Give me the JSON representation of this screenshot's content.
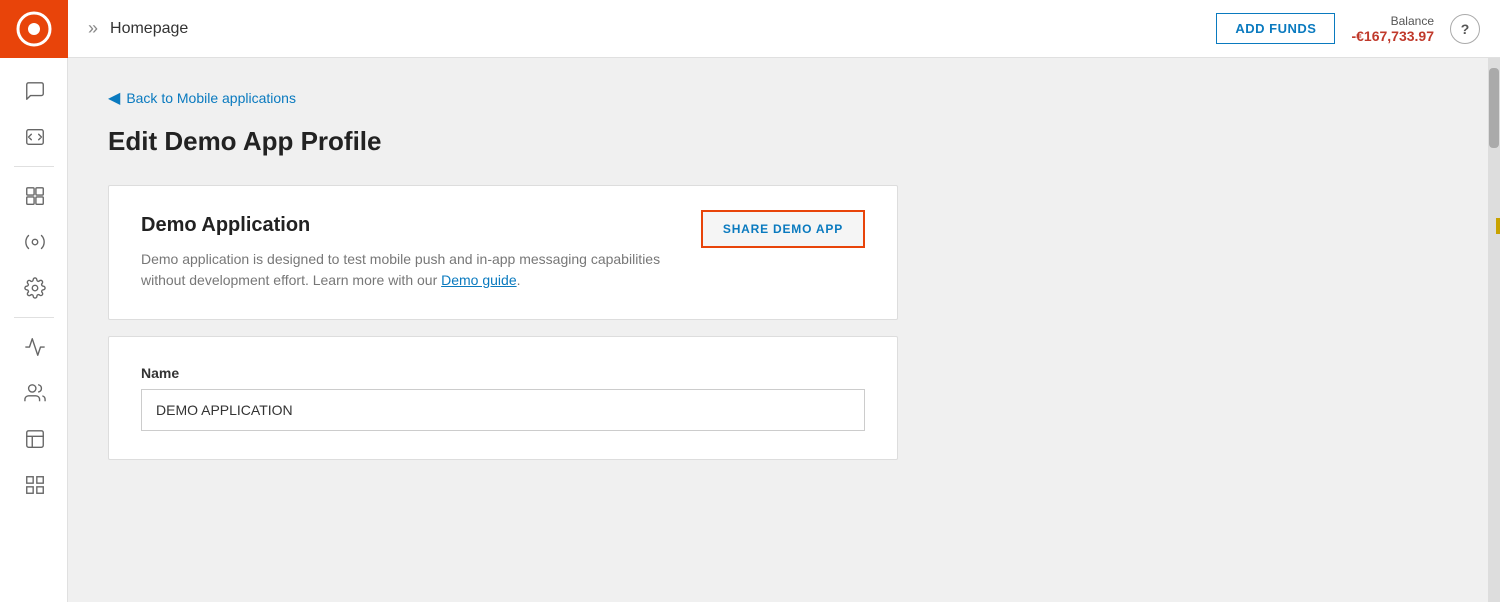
{
  "logo": {
    "alt": "Braze logo"
  },
  "topbar": {
    "breadcrumb": "Homepage",
    "chevron": "»",
    "add_funds_label": "ADD FUNDS",
    "balance_label": "Balance",
    "balance_value": "-€167,733.97",
    "help_icon": "?"
  },
  "sidebar": {
    "items": [
      {
        "name": "chat-icon",
        "label": "Messages"
      },
      {
        "name": "code-icon",
        "label": "Developer"
      },
      {
        "name": "template-icon",
        "label": "Templates"
      },
      {
        "name": "automation-icon",
        "label": "Automation"
      },
      {
        "name": "settings-icon",
        "label": "Settings"
      },
      {
        "name": "analytics-icon",
        "label": "Analytics"
      },
      {
        "name": "audience-icon",
        "label": "Audience"
      },
      {
        "name": "reports-icon",
        "label": "Reports"
      },
      {
        "name": "grid-icon",
        "label": "Grid"
      }
    ]
  },
  "back_link": "Back to Mobile applications",
  "page_title": "Edit Demo App Profile",
  "demo_card": {
    "title": "Demo Application",
    "description_part1": "Demo application is designed to test mobile push and in-app messaging capabilities without development effort. Learn more with our ",
    "demo_guide_link": "Demo guide",
    "description_part2": ".",
    "share_button_label": "SHARE DEMO APP"
  },
  "form_card": {
    "name_label": "Name",
    "name_value": "DEMO APPLICATION",
    "name_placeholder": "DEMO APPLICATION"
  }
}
